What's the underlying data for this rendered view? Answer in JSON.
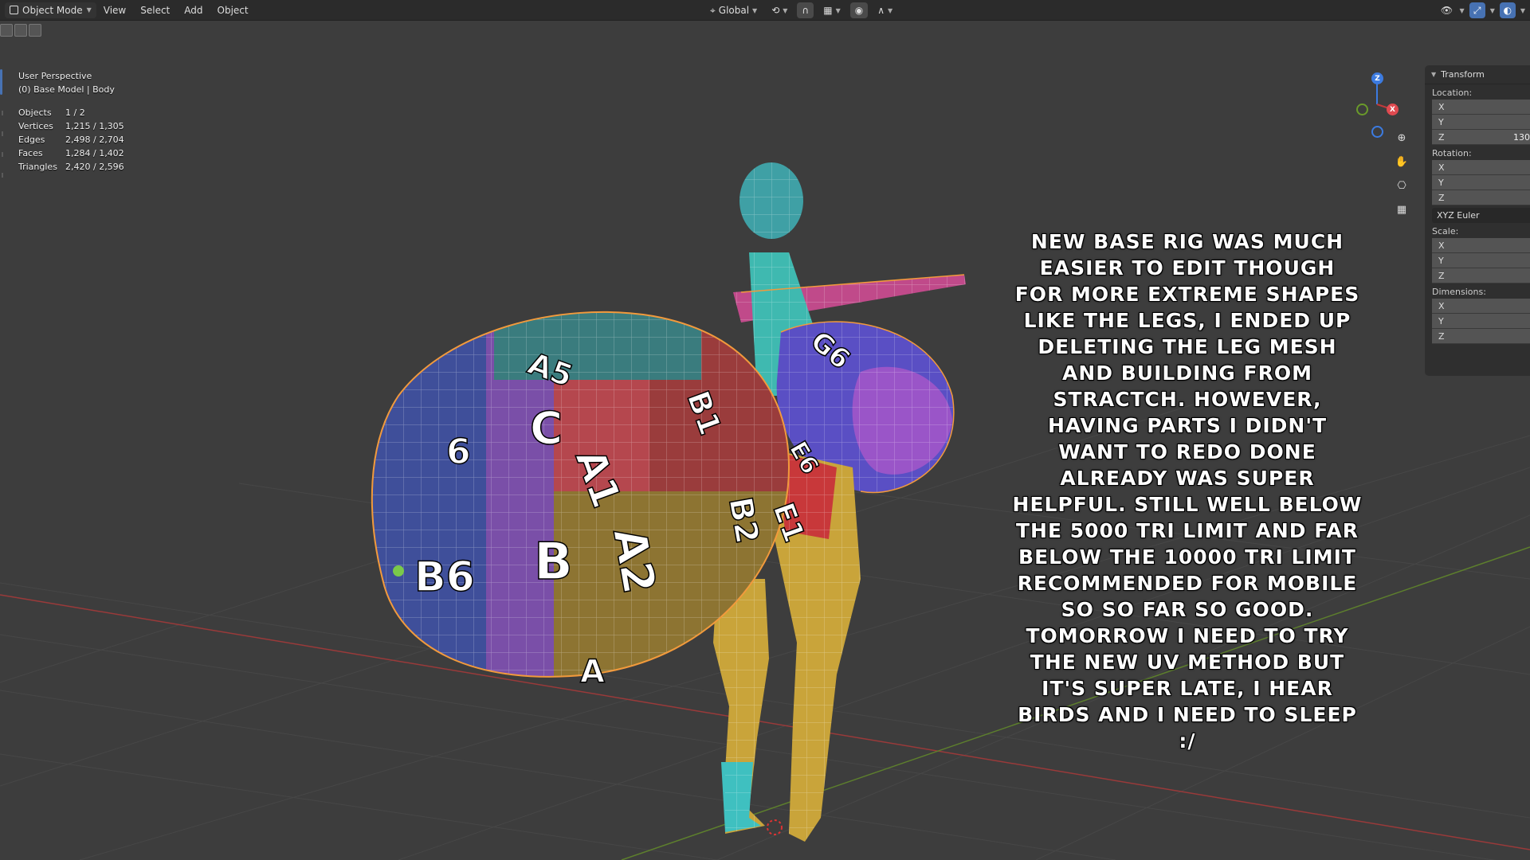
{
  "header": {
    "mode": "Object Mode",
    "menus": [
      "View",
      "Select",
      "Add",
      "Object"
    ],
    "orientation": "Global"
  },
  "overlay": {
    "perspective": "User Perspective",
    "collection": "(0) Base Model | Body",
    "stats": [
      {
        "label": "Objects",
        "value": "1 / 2"
      },
      {
        "label": "Vertices",
        "value": "1,215 / 1,305"
      },
      {
        "label": "Edges",
        "value": "2,498 / 2,704"
      },
      {
        "label": "Faces",
        "value": "1,284 / 1,402"
      },
      {
        "label": "Triangles",
        "value": "2,420 / 2,596"
      }
    ]
  },
  "gizmo": {
    "z": "Z",
    "x": "X"
  },
  "properties": {
    "title": "Transform",
    "location": {
      "label": "Location:",
      "x": "X",
      "y": "Y",
      "z": "Z",
      "z_value": "130"
    },
    "rotation": {
      "label": "Rotation:",
      "x": "X",
      "y": "Y",
      "z": "Z",
      "mode": "XYZ Euler"
    },
    "scale": {
      "label": "Scale:",
      "x": "X",
      "y": "Y",
      "z": "Z"
    },
    "dimensions": {
      "label": "Dimensions:",
      "x": "X",
      "y": "Y",
      "z": "Z"
    }
  },
  "annotation": "New base rig was much easier to edit though for more extreme shapes like the legs, I ended up deleting the leg mesh and building from stractch. However, having parts I didn't want to redo done already was super helpful. Still well below the 5000 tri limit and far below the 10000 tri limit recommended for mobile so so far so good. Tomorrow I need to try the new UV method but it's super late, I hear birds and I need to sleep :/",
  "model_labels": [
    "A5",
    "A1",
    "B1",
    "C",
    "6",
    "B6",
    "B",
    "A2",
    "B2",
    "E1",
    "E6",
    "G6",
    "A"
  ],
  "colors": {
    "viewport_bg": "#3d3d3d",
    "header_bg": "#2b2b2b",
    "accent_blue": "#4772b3",
    "selection_outline": "#f29a3c",
    "axis_x_red": "#c0393b",
    "axis_y_green": "#6a9a2a",
    "axis_z_blue": "#3c7be0"
  }
}
